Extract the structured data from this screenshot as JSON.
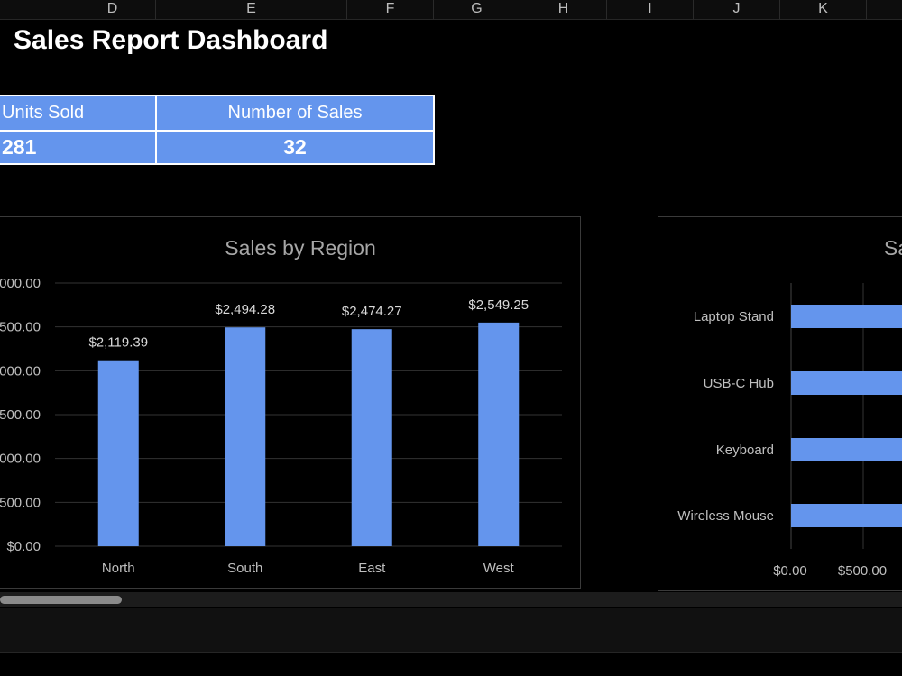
{
  "sheet": {
    "columns": [
      "D",
      "E",
      "F",
      "G",
      "H",
      "I",
      "J",
      "K"
    ],
    "title": "Sales Report Dashboard"
  },
  "kpis": {
    "headers": [
      "Units Sold",
      "Number of Sales"
    ],
    "values": [
      "281",
      "32"
    ],
    "color": "#6495ed"
  },
  "chart_data": [
    {
      "type": "bar",
      "title": "Sales by Region",
      "categories": [
        "North",
        "South",
        "East",
        "West"
      ],
      "values": [
        2119.39,
        2494.28,
        2474.27,
        2549.25
      ],
      "data_labels": [
        "$2,119.39",
        "$2,494.28",
        "$2,474.27",
        "$2,549.25"
      ],
      "y_tick_labels": [
        "$0.00",
        "500.00",
        "000.00",
        "500.00",
        "000.00",
        "500.00",
        "000.00"
      ],
      "ylim": [
        0,
        3000
      ],
      "grid": true,
      "color": "#6495ed"
    },
    {
      "type": "bar",
      "orientation": "horizontal",
      "title": "Sa",
      "categories": [
        "Laptop Stand",
        "USB-C Hub",
        "Keyboard",
        "Wireless Mouse"
      ],
      "x_tick_labels": [
        "$0.00",
        "$500.00"
      ],
      "grid": true,
      "color": "#6495ed"
    }
  ]
}
